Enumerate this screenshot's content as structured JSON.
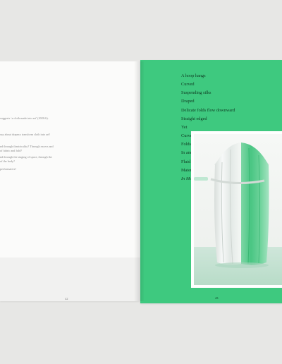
{
  "left_page": {
    "lines": [
      "suggests ‘a cloth made into art’ (2020:6).",
      "say about drapery transform cloth into art?",
      "nd through theatricality? Through excess and",
      "of fabric and fold?",
      "nd through the staging of space, through the",
      "of the body?",
      "performative?"
    ],
    "page_number": "42"
  },
  "right_page": {
    "poem_lines": [
      "A hoop hangs",
      "Curved",
      "Suspending silks",
      "Draped",
      "Delicate folds flow downward",
      "Straight edged",
      "Yet",
      "Curved",
      "Folds ebb and flow",
      "In and out",
      "Fluid",
      "Material",
      "In Motion"
    ],
    "italic_line": "In Motion",
    "page_number": "43",
    "background_color": "#3ec97f"
  },
  "photo": {
    "subject": "draped-silk-sculpture-image"
  }
}
